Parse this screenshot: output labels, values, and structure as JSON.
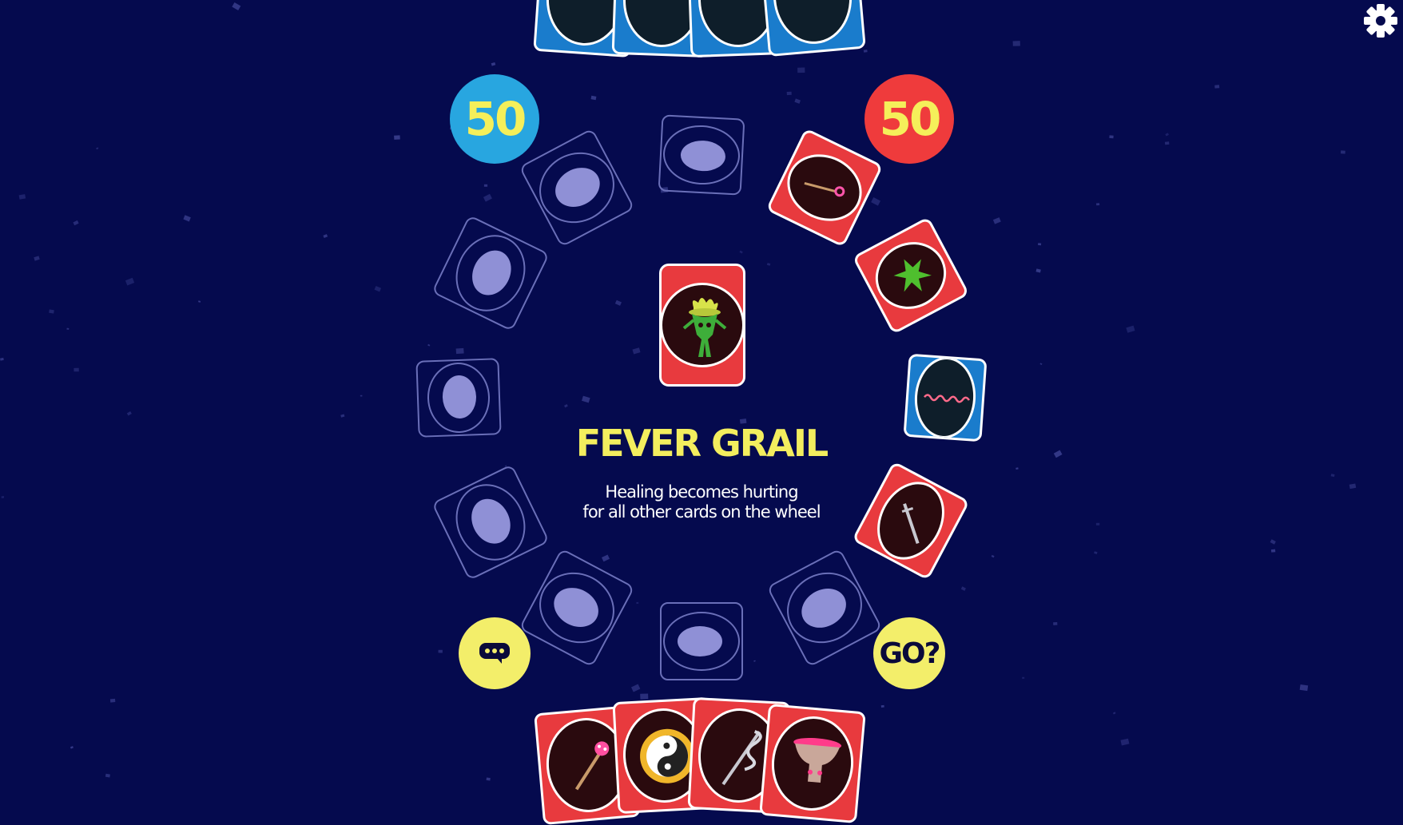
{
  "game": {
    "scores": {
      "left": "50",
      "right": "50"
    },
    "colors": {
      "background": "#050a4e",
      "player_left": "#28a6e0",
      "player_right": "#ef3b3c",
      "accent_yellow": "#f3ee5e",
      "red_card": "#e83a3e",
      "blue_card": "#1a7ccc"
    },
    "current_card": {
      "title": "FEVER GRAIL",
      "description_line1": "Healing becomes hurting",
      "description_line2": "for all other cards on the wheel",
      "icon": "green-creature-icon"
    },
    "buttons": {
      "go_label": "GO?",
      "chat_icon": "speech-bubble-icon",
      "settings_icon": "gear-icon"
    },
    "wheel_cards": [
      {
        "kind": "empty"
      },
      {
        "kind": "red",
        "icon": "staff-icon"
      },
      {
        "kind": "red",
        "icon": "splat-icon"
      },
      {
        "kind": "blue",
        "icon": "thread-icon"
      },
      {
        "kind": "red",
        "icon": "sword-icon"
      },
      {
        "kind": "empty"
      },
      {
        "kind": "empty"
      },
      {
        "kind": "empty"
      },
      {
        "kind": "empty"
      },
      {
        "kind": "empty"
      },
      {
        "kind": "empty"
      },
      {
        "kind": "empty"
      }
    ],
    "opponent_hand": {
      "count": 4,
      "color": "blue"
    },
    "player_hand": [
      {
        "icon": "mushroom-staff-icon"
      },
      {
        "icon": "yin-yang-icon"
      },
      {
        "icon": "serpent-staff-icon"
      },
      {
        "icon": "pink-grail-icon"
      }
    ]
  }
}
